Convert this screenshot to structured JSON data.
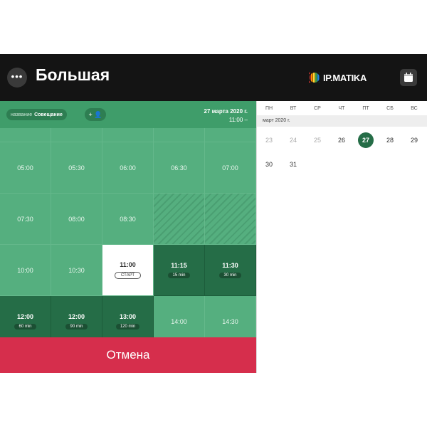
{
  "header": {
    "menu_icon": "more-dots-icon",
    "menu_label": "•••",
    "room_title": "Большая",
    "brand_name": "IP.MATIKA",
    "brand_icon": "rainbow-globe-icon",
    "calendar_icon": "calendar-icon"
  },
  "booking": {
    "name_label": "название",
    "name_value": "Совещание",
    "add_person_label": "+ 👤",
    "date": "27 марта 2020 г.",
    "time_range": "11:00 –",
    "slots": [
      {
        "time": "",
        "state": "free",
        "row": "top"
      },
      {
        "time": "",
        "state": "free",
        "row": "top"
      },
      {
        "time": "",
        "state": "free",
        "row": "top"
      },
      {
        "time": "",
        "state": "free",
        "row": "top"
      },
      {
        "time": "",
        "state": "free",
        "row": "top"
      },
      {
        "time": "05:00",
        "state": "free"
      },
      {
        "time": "05:30",
        "state": "free"
      },
      {
        "time": "06:00",
        "state": "free"
      },
      {
        "time": "06:30",
        "state": "free"
      },
      {
        "time": "07:00",
        "state": "free"
      },
      {
        "time": "07:30",
        "state": "free"
      },
      {
        "time": "08:00",
        "state": "free"
      },
      {
        "time": "08:30",
        "state": "free"
      },
      {
        "time": "",
        "state": "hatched"
      },
      {
        "time": "",
        "state": "hatched"
      },
      {
        "time": "10:00",
        "state": "free"
      },
      {
        "time": "10:30",
        "state": "free"
      },
      {
        "time": "11:00",
        "state": "selected",
        "action": "СТАРТ"
      },
      {
        "time": "11:15",
        "state": "busy",
        "duration": "15 min"
      },
      {
        "time": "11:30",
        "state": "busy",
        "duration": "30 min"
      },
      {
        "time": "12:00",
        "state": "busy",
        "duration": "60 min"
      },
      {
        "time": "12:00",
        "state": "busy",
        "duration": "90 min"
      },
      {
        "time": "13:00",
        "state": "busy",
        "duration": "120 min"
      },
      {
        "time": "14:00",
        "state": "free"
      },
      {
        "time": "14:30",
        "state": "free"
      }
    ],
    "cancel_label": "Отмена"
  },
  "calendar": {
    "weekdays": [
      "ПН",
      "ВТ",
      "СР",
      "ЧТ",
      "ПТ",
      "СБ",
      "ВС"
    ],
    "month_label": "март 2020 г.",
    "days": [
      {
        "d": "23",
        "state": "past"
      },
      {
        "d": "24",
        "state": "past"
      },
      {
        "d": "25",
        "state": "past"
      },
      {
        "d": "26",
        "state": "normal"
      },
      {
        "d": "27",
        "state": "today"
      },
      {
        "d": "28",
        "state": "normal"
      },
      {
        "d": "29",
        "state": "normal"
      },
      {
        "d": "30",
        "state": "normal"
      },
      {
        "d": "31",
        "state": "normal"
      }
    ]
  },
  "colors": {
    "topbar": "#141414",
    "green": "#55af7f",
    "dark_green": "#256d47",
    "cancel_red": "#d62e4c"
  }
}
